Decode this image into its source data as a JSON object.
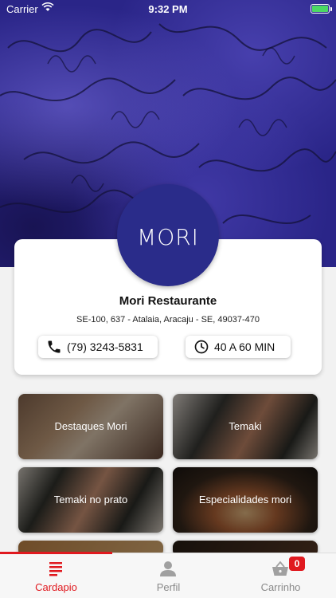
{
  "status_bar": {
    "carrier": "Carrier",
    "time": "9:32 PM"
  },
  "restaurant": {
    "name": "Mori Restaurante",
    "address": "SE-100, 637 - Atalaia, Aracaju - SE, 49037-470",
    "phone": "(79) 3243-5831",
    "delivery_time": "40 A 60 MIN",
    "logo_text": "MORI"
  },
  "categories": [
    {
      "label": "Destaques Mori"
    },
    {
      "label": "Temaki"
    },
    {
      "label": "Temaki no prato"
    },
    {
      "label": "Especialidades mori"
    }
  ],
  "tabbar": {
    "items": [
      {
        "label": "Cardapio",
        "icon": "menu-list-icon",
        "active": true
      },
      {
        "label": "Perfil",
        "icon": "user-icon",
        "active": false
      },
      {
        "label": "Carrinho",
        "icon": "basket-icon",
        "active": false
      }
    ],
    "cart_count": "0"
  },
  "colors": {
    "accent": "#e0191f",
    "brand": "#2a2c8a"
  }
}
